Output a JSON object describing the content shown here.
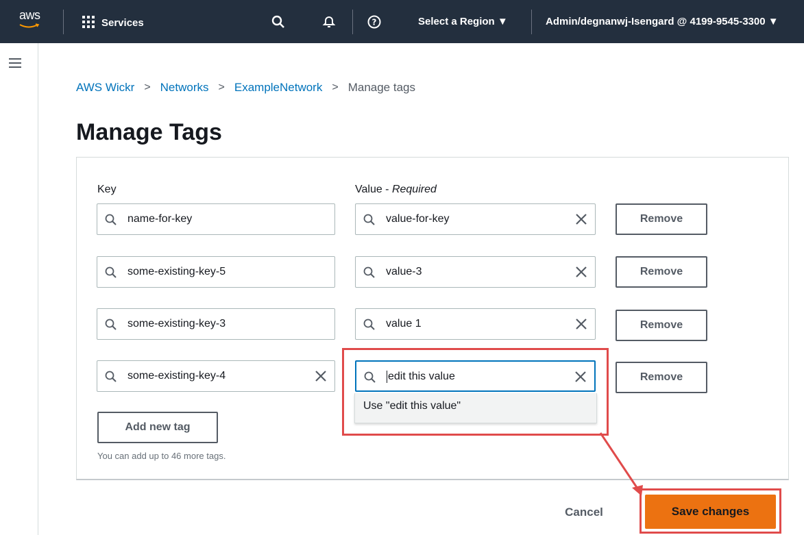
{
  "topnav": {
    "logo_text": "aws",
    "services_label": "Services",
    "region_label": "Select a Region ▼",
    "account_label": "Admin/degnanwj-Isengard @ 4199-9545-3300 ▼",
    "bg_color": "#232f3e"
  },
  "breadcrumb": {
    "items": [
      "AWS Wickr",
      "Networks",
      "ExampleNetwork"
    ],
    "current": "Manage tags",
    "separator": ">"
  },
  "page_title": "Manage Tags",
  "tags": {
    "key_label": "Key",
    "value_label": "Value - ",
    "value_required": "Required",
    "rows": [
      {
        "key": "name-for-key",
        "value": "value-for-key",
        "remove": "Remove"
      },
      {
        "key": "some-existing-key-5",
        "value": "value-3",
        "remove": "Remove"
      },
      {
        "key": "some-existing-key-3",
        "value": "value 1",
        "remove": "Remove"
      },
      {
        "key": "some-existing-key-4",
        "value": "edit this value",
        "remove": "Remove"
      }
    ],
    "suggestion": "Use \"edit this value\"",
    "add_button": "Add new tag",
    "hint": "You can add up to 46 more tags."
  },
  "footer": {
    "cancel": "Cancel",
    "save": "Save changes",
    "save_color": "#ec7211",
    "highlight_color": "#e04b4b"
  }
}
